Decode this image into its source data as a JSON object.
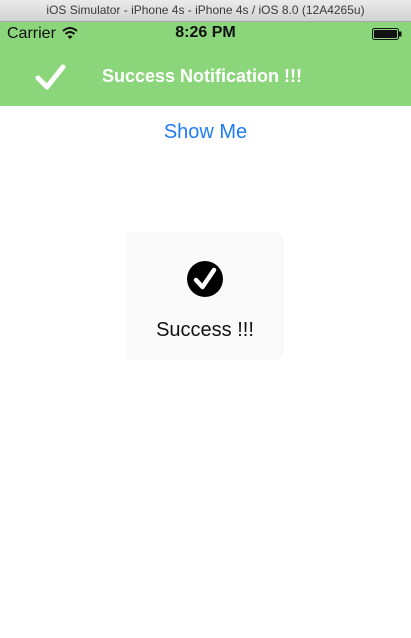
{
  "window": {
    "title": "iOS Simulator - iPhone 4s - iPhone 4s / iOS 8.0 (12A4265u)"
  },
  "status_bar": {
    "carrier": "Carrier",
    "wifi_icon": "wifi-icon",
    "time": "8:26 PM",
    "battery_icon": "battery-icon"
  },
  "notification": {
    "icon": "checkmark-icon",
    "title": "Success Notification !!!",
    "background_color": "#8bd57b"
  },
  "main": {
    "show_me_label": "Show Me",
    "accent_color": "#1f7cf2"
  },
  "hud": {
    "icon": "check-circle-icon",
    "label": "Success !!!"
  }
}
